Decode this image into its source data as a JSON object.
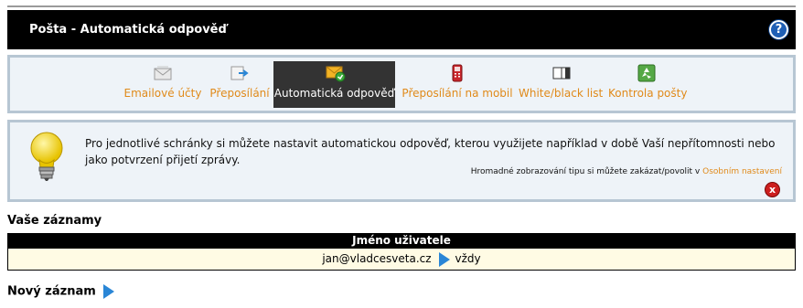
{
  "header": {
    "title": "Pošta - Automatická odpověď",
    "help_label": "?"
  },
  "nav": {
    "items": [
      {
        "label": "Emailové účty",
        "icon": "envelope-icon"
      },
      {
        "label": "Přeposílání",
        "icon": "forward-icon"
      },
      {
        "label": "Automatická odpověď",
        "icon": "auto-reply-icon",
        "active": true
      },
      {
        "label": "Přeposílání na mobil",
        "icon": "mobile-phone-icon"
      },
      {
        "label": "White/black list",
        "icon": "book-icon"
      },
      {
        "label": "Kontrola pošty",
        "icon": "recycle-icon"
      }
    ]
  },
  "tip": {
    "text": "Pro jednotlivé schránky si můžete nastavit automatickou odpověď, kterou využijete například v době Vaší nepřítomnosti nebo jako potvrzení přijetí zprávy.",
    "hint_prefix": "Hromadné zobrazování tipu si můžete zakázat/povolit v",
    "hint_link": "Osobním nastavení",
    "close_label": "x"
  },
  "records": {
    "section_title": "Vaše záznamy",
    "column_header": "Jméno uživatele",
    "rows": [
      {
        "email": "jan@vladcesveta.cz",
        "when": "vždy"
      }
    ]
  },
  "new_record_label": "Nový záznam",
  "colors": {
    "accent": "#e08a1a",
    "panel_bg": "#eef3f8",
    "panel_border": "#b7c6d3",
    "row_bg": "#fffbe4",
    "arrow": "#2a86d6"
  }
}
